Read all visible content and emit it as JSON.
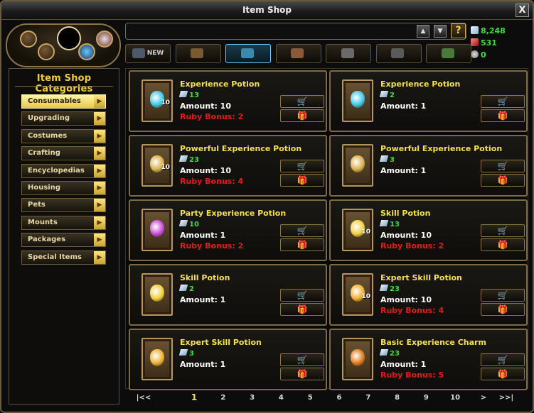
{
  "window": {
    "title": "Item Shop",
    "close_label": "X"
  },
  "toolbar": {
    "up_label": "▲",
    "down_label": "▼",
    "help_label": "?"
  },
  "currency": {
    "crystals": "8,248",
    "rubies": "531",
    "silver": "0",
    "crystal_color": "#38e038"
  },
  "tabs": [
    {
      "label": "NEW",
      "icon": "new-tab-icon"
    },
    {
      "label": "",
      "icon": "ornament-tab-icon"
    },
    {
      "label": "",
      "icon": "crystal-tab-icon"
    },
    {
      "label": "",
      "icon": "armor-tab-icon"
    },
    {
      "label": "",
      "icon": "coin-tab-icon"
    },
    {
      "label": "",
      "icon": "wing-tab-icon"
    },
    {
      "label": "",
      "icon": "mount-tab-icon"
    }
  ],
  "sidebar": {
    "title": "Item Shop Categories",
    "items": [
      {
        "label": "Consumables",
        "selected": true
      },
      {
        "label": "Upgrading"
      },
      {
        "label": "Costumes"
      },
      {
        "label": "Crafting"
      },
      {
        "label": "Encyclopedias"
      },
      {
        "label": "Housing"
      },
      {
        "label": "Pets"
      },
      {
        "label": "Mounts"
      },
      {
        "label": "Packages"
      },
      {
        "label": "Special Items"
      }
    ]
  },
  "items": [
    {
      "name": "Experience Potion",
      "price": "13",
      "amount": "Amount: 10",
      "bonus": "Ruby Bonus: 2",
      "qty": "10",
      "color": "#3fc6e8"
    },
    {
      "name": "Experience Potion",
      "price": "2",
      "amount": "Amount: 1",
      "bonus": "",
      "qty": "",
      "color": "#3fc6e8"
    },
    {
      "name": "Powerful Experience Potion",
      "price": "23",
      "amount": "Amount: 10",
      "bonus": "Ruby Bonus: 4",
      "qty": "10",
      "color": "#d8b04a"
    },
    {
      "name": "Powerful Experience Potion",
      "price": "3",
      "amount": "Amount: 1",
      "bonus": "",
      "qty": "",
      "color": "#d8b04a"
    },
    {
      "name": "Party Experience Potion",
      "price": "10",
      "amount": "Amount: 1",
      "bonus": "Ruby Bonus: 2",
      "qty": "",
      "color": "#c94ad8"
    },
    {
      "name": "Skill Potion",
      "price": "13",
      "amount": "Amount: 10",
      "bonus": "Ruby Bonus: 2",
      "qty": "10",
      "color": "#f0d03a"
    },
    {
      "name": "Skill Potion",
      "price": "2",
      "amount": "Amount: 1",
      "bonus": "",
      "qty": "",
      "color": "#f0d03a"
    },
    {
      "name": "Expert Skill Potion",
      "price": "23",
      "amount": "Amount: 10",
      "bonus": "Ruby Bonus: 4",
      "qty": "10",
      "color": "#f0b030"
    },
    {
      "name": "Expert Skill Potion",
      "price": "3",
      "amount": "Amount: 1",
      "bonus": "",
      "qty": "",
      "color": "#f0b030"
    },
    {
      "name": "Basic Experience Charm",
      "price": "23",
      "amount": "Amount: 1",
      "bonus": "Ruby Bonus: 5",
      "qty": "",
      "color": "#e07a18"
    }
  ],
  "pagination": {
    "first": "|<<",
    "pages": [
      "1",
      "2",
      "3",
      "4",
      "5",
      "6",
      "7",
      "8",
      "9",
      "10"
    ],
    "current": "1",
    "next": ">",
    "last": ">>|"
  }
}
